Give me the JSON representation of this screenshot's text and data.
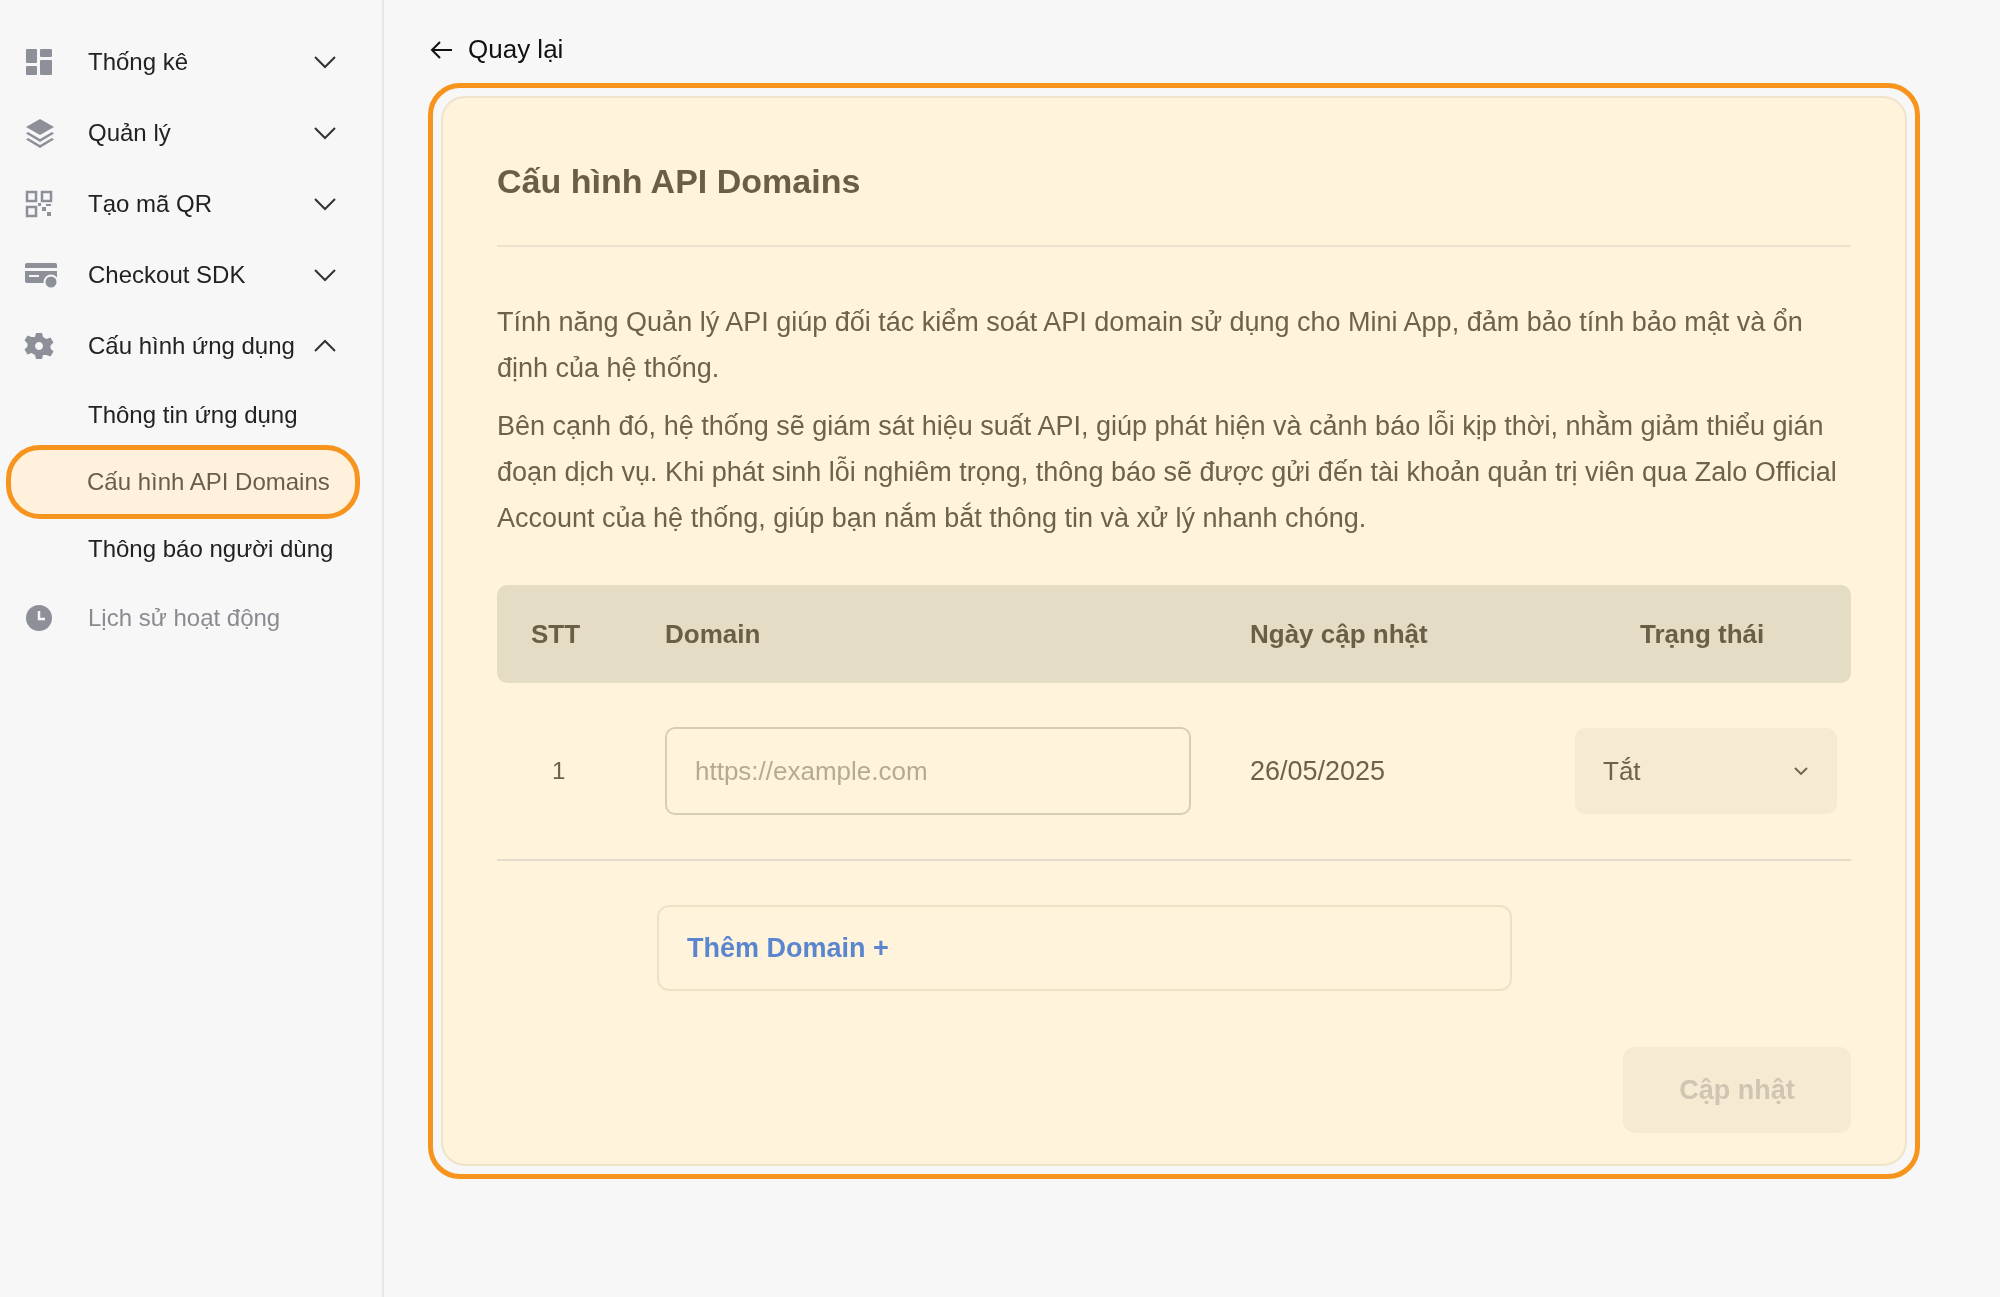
{
  "sidebar": {
    "items": [
      {
        "kind": "group",
        "label": "Thống kê",
        "expanded": false,
        "disabled": false
      },
      {
        "kind": "group",
        "label": "Quản lý",
        "expanded": false,
        "disabled": false
      },
      {
        "kind": "group",
        "label": "Tạo mã QR",
        "expanded": false,
        "disabled": false
      },
      {
        "kind": "group",
        "label": "Checkout SDK",
        "expanded": false,
        "disabled": false
      },
      {
        "kind": "group",
        "label": "Cấu hình ứng dụng",
        "expanded": true,
        "disabled": false,
        "children": [
          {
            "label": "Thông tin ứng dụng",
            "selected": false
          },
          {
            "label": "Cấu hình API Domains",
            "selected": true
          },
          {
            "label": "Thông báo người dùng",
            "selected": false
          }
        ]
      },
      {
        "kind": "link",
        "label": "Lịch sử hoạt động",
        "disabled": true
      }
    ]
  },
  "back_link": "Quay lại",
  "card": {
    "highlighted": true,
    "title": "Cấu hình API Domains",
    "paragraphs": [
      "Tính năng Quản lý API giúp đối tác kiểm soát API domain sử dụng cho Mini App, đảm bảo tính bảo mật và ổn định của hệ thống.",
      "Bên cạnh đó, hệ thống sẽ giám sát hiệu suất API, giúp phát hiện và cảnh báo lỗi kịp thời, nhằm giảm thiểu gián đoạn dịch vụ. Khi phát sinh lỗi nghiêm trọng, thông báo sẽ được gửi đến tài khoản quản trị viên qua Zalo Official Account của hệ thống, giúp bạn nắm bắt thông tin và xử lý nhanh chóng."
    ],
    "table": {
      "columns": [
        "STT",
        "Domain",
        "Ngày cập nhật",
        "Trạng thái"
      ],
      "rows": [
        {
          "stt": "1",
          "domain_placeholder": "https://example.com",
          "updated": "26/05/2025",
          "status": "Tắt"
        }
      ]
    },
    "add_button": "Thêm Domain +",
    "update_button": {
      "label": "Cập nhật",
      "disabled": true
    }
  }
}
